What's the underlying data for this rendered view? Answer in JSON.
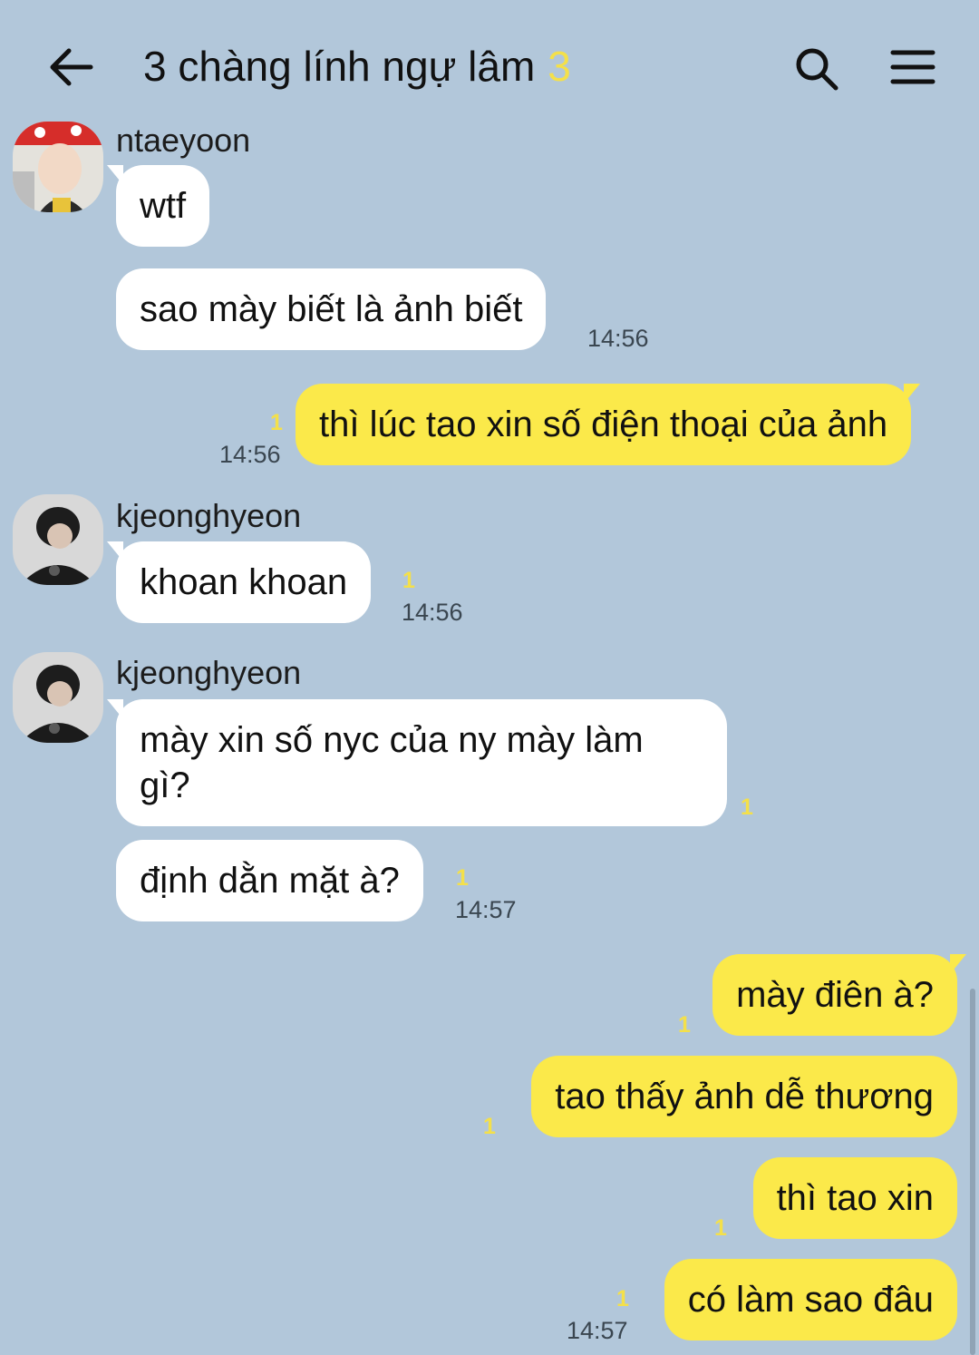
{
  "header": {
    "title": "3 chàng lính ngự lâm",
    "member_count": "3",
    "back_icon": "arrow-left-icon",
    "search_icon": "search-icon",
    "menu_icon": "hamburger-menu-icon"
  },
  "colors": {
    "background": "#b2c7da",
    "incoming_bubble": "#ffffff",
    "outgoing_bubble": "#fbe94a",
    "unread_count": "#f4e04a"
  },
  "messages": [
    {
      "sender": "ntaeyoon",
      "text": "wtf"
    },
    {
      "text": "sao mày biết là ảnh biết",
      "time": "14:56"
    },
    {
      "outgoing": true,
      "text": "thì lúc tao xin số điện thoại của ảnh",
      "unread": "1",
      "time": "14:56"
    },
    {
      "sender": "kjeonghyeon",
      "text": "khoan khoan",
      "unread": "1",
      "time": "14:56"
    },
    {
      "sender": "kjeonghyeon",
      "text": "mày xin số nyc của ny mày làm gì?",
      "unread": "1"
    },
    {
      "text": "định dằn mặt à?",
      "unread": "1",
      "time": "14:57"
    },
    {
      "outgoing": true,
      "text": "mày điên à?",
      "unread": "1"
    },
    {
      "outgoing": true,
      "text": "tao thấy ảnh dễ thương",
      "unread": "1"
    },
    {
      "outgoing": true,
      "text": "thì tao xin",
      "unread": "1"
    },
    {
      "outgoing": true,
      "text": "có làm sao đâu",
      "unread": "1",
      "time": "14:57"
    }
  ]
}
